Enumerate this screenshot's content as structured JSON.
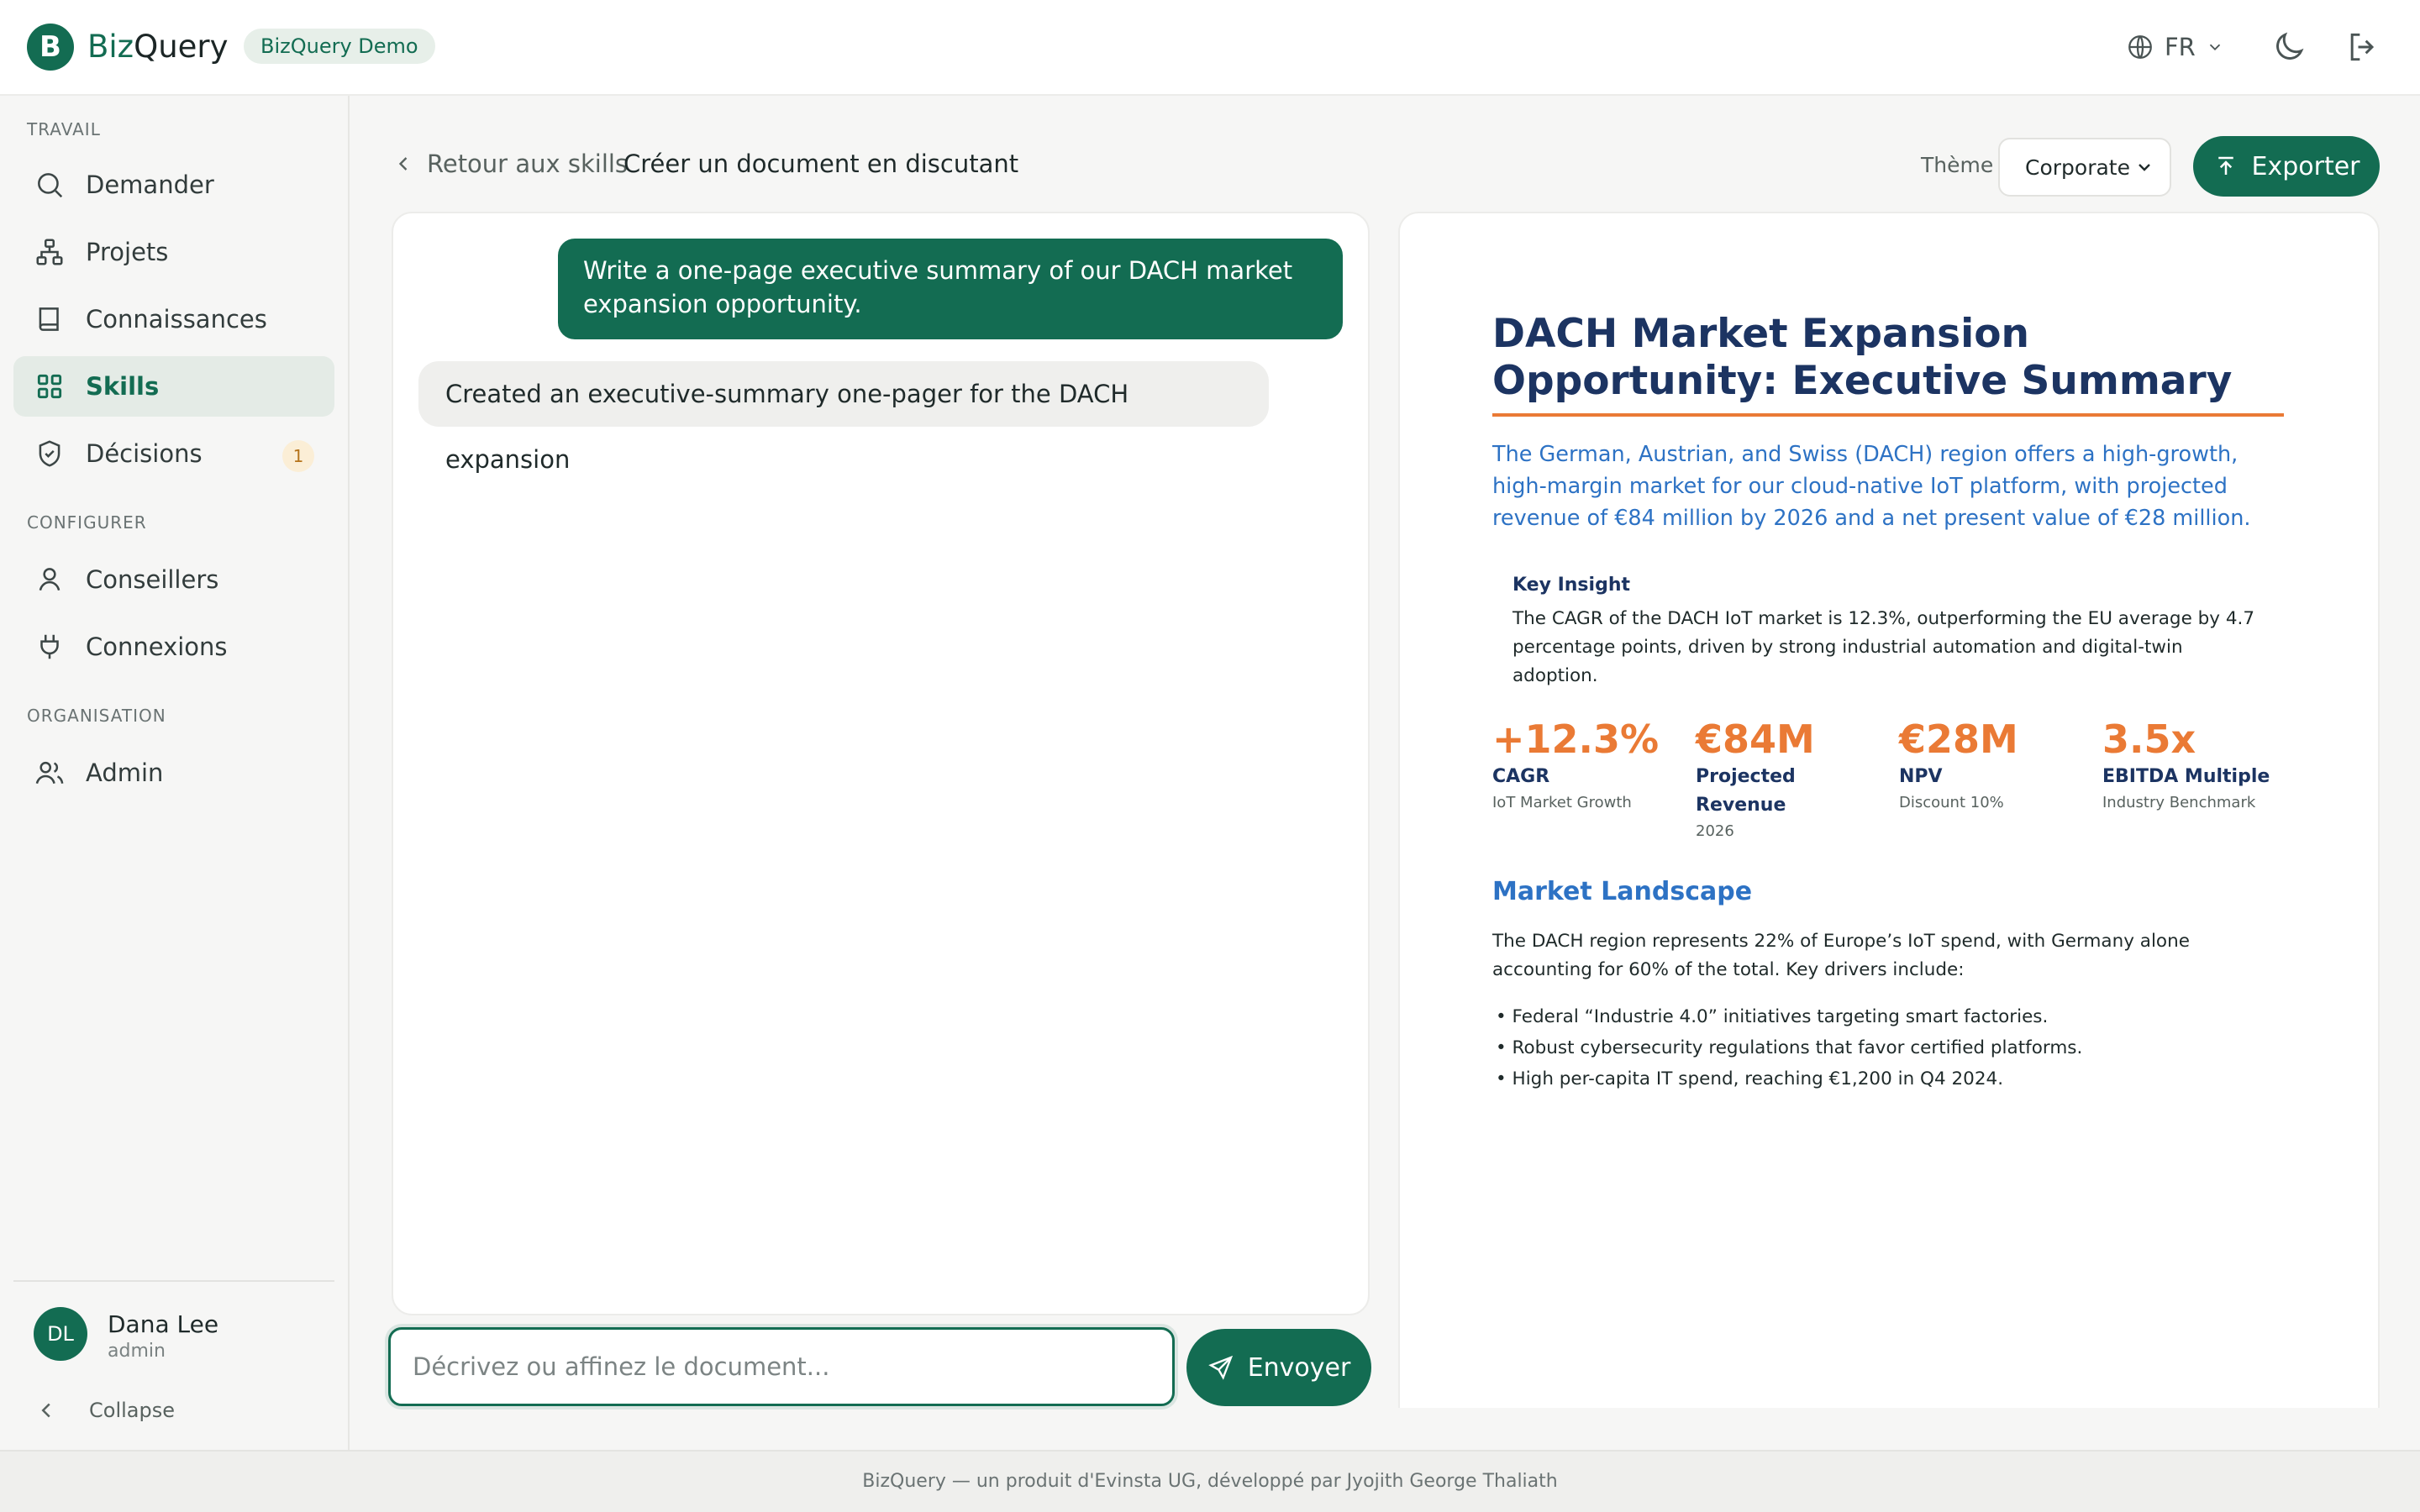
{
  "app": {
    "name_prefix": "Biz",
    "name_suffix": "Query",
    "logo_letter": "B",
    "workspace_badge": "BizQuery Demo"
  },
  "header": {
    "language": "FR"
  },
  "sidebar": {
    "sections": [
      "TRAVAIL",
      "CONFIGURER",
      "ORGANISATION"
    ],
    "items": [
      {
        "label": "Demander",
        "icon": "search-icon"
      },
      {
        "label": "Projets",
        "icon": "hierarchy-icon"
      },
      {
        "label": "Connaissances",
        "icon": "book-icon"
      },
      {
        "label": "Skills",
        "icon": "grid-icon",
        "active": true
      },
      {
        "label": "Décisions",
        "icon": "shield-check-icon",
        "count": "1"
      },
      {
        "label": "Conseillers",
        "icon": "user-icon"
      },
      {
        "label": "Connexions",
        "icon": "plug-icon"
      },
      {
        "label": "Admin",
        "icon": "users-icon"
      }
    ],
    "user": {
      "initials": "DL",
      "name": "Dana Lee",
      "role": "admin"
    },
    "collapse_label": "Collapse"
  },
  "main": {
    "back_label": "Retour aux skills",
    "title": "Créer un document en discutant",
    "theme_label": "Thème",
    "theme_value": "Corporate",
    "export_label": "Exporter"
  },
  "chat": {
    "user_message": "Write a one-page executive summary of our DACH market expansion opportunity.",
    "assistant_message": "Created an executive-summary one-pager for the DACH expansion",
    "input_placeholder": "Décrivez ou affinez le document...",
    "send_label": "Envoyer"
  },
  "document": {
    "title": "DACH Market Expansion Opportunity: Executive Summary",
    "lead": "The German, Austrian, and Swiss (DACH) region offers a high-growth, high-margin market for our cloud-native IoT platform, with projected revenue of €84 million by 2026 and a net present value of €28 million.",
    "insight_title": "Key Insight",
    "insight_text": "The CAGR of the DACH IoT market is 12.3%, outperforming the EU average by 4.7 percentage points, driven by strong industrial automation and digital-twin adoption.",
    "kpis": [
      {
        "value": "+12.3%",
        "label": "CAGR",
        "sub": "IoT Market Growth"
      },
      {
        "value": "€84M",
        "label": "Projected Revenue",
        "sub": "2026"
      },
      {
        "value": "€28M",
        "label": "NPV",
        "sub": "Discount 10%"
      },
      {
        "value": "3.5x",
        "label": "EBITDA Multiple",
        "sub": "Industry Benchmark"
      }
    ],
    "section_title": "Market Landscape",
    "section_text": "The DACH region represents 22% of Europe’s IoT spend, with Germany alone accounting for 60% of the total. Key drivers include:",
    "bullets": [
      "Federal “Industrie 4.0” initiatives targeting smart factories.",
      "Robust cybersecurity regulations that favor certified platforms.",
      "High per-capita IT spend, reaching €1,200 in Q4 2024."
    ]
  },
  "footer": {
    "text": "BizQuery — un produit d'Evinsta UG, développé par Jyojith George Thaliath"
  },
  "colors": {
    "brand": "#136c52",
    "doc_heading": "#1c3462",
    "doc_accent": "#ea7a35",
    "doc_link": "#2d72c4"
  }
}
